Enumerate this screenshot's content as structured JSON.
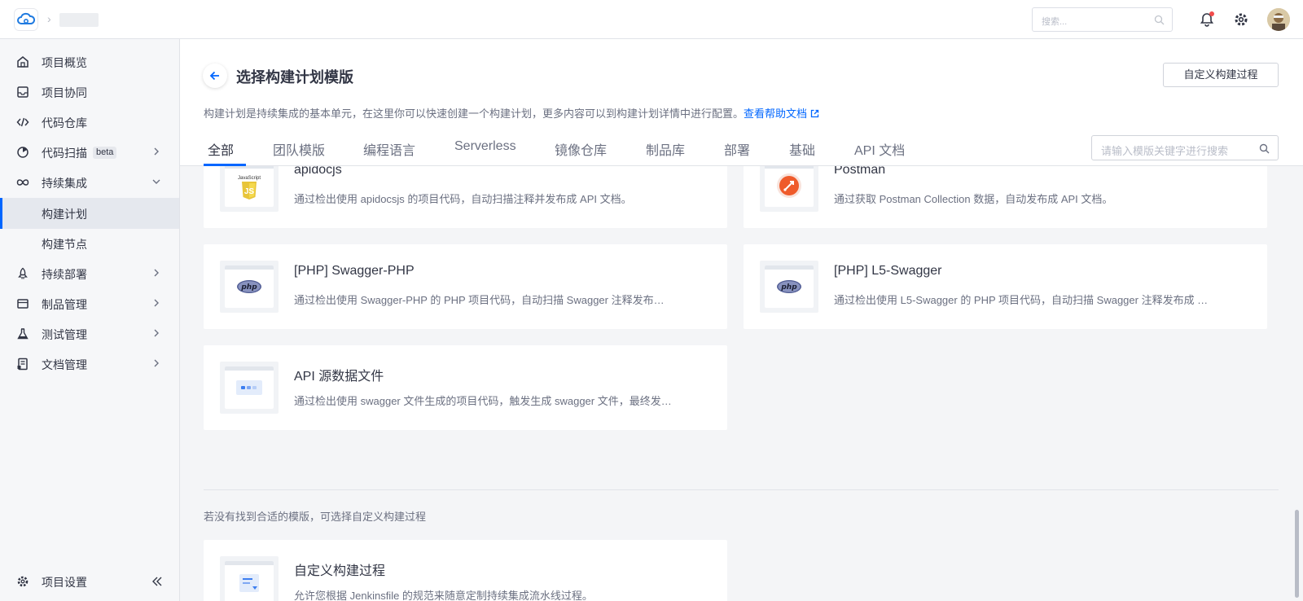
{
  "topbar": {
    "search_placeholder": "搜索..."
  },
  "sidebar": {
    "items": [
      {
        "label": "项目概览",
        "icon": "home-icon"
      },
      {
        "label": "项目协同",
        "icon": "inbox-icon"
      },
      {
        "label": "代码仓库",
        "icon": "code-icon"
      },
      {
        "label": "代码扫描",
        "icon": "scan-icon",
        "badge": "beta"
      },
      {
        "label": "持续集成",
        "icon": "infinity-icon"
      },
      {
        "label": "构建计划",
        "sub": true,
        "active": true
      },
      {
        "label": "构建节点",
        "sub": true
      },
      {
        "label": "持续部署",
        "icon": "rocket-icon"
      },
      {
        "label": "制品管理",
        "icon": "box-icon"
      },
      {
        "label": "测试管理",
        "icon": "flask-icon"
      },
      {
        "label": "文档管理",
        "icon": "document-icon"
      }
    ],
    "settings_label": "项目设置"
  },
  "header": {
    "title": "选择构建计划模版",
    "custom_button": "自定义构建过程",
    "description": "构建计划是持续集成的基本单元，在这里你可以快速创建一个构建计划，更多内容可以到构建计划详情中进行配置。",
    "help_link": "查看帮助文档"
  },
  "tabs": [
    {
      "label": "全部",
      "active": true
    },
    {
      "label": "团队模版"
    },
    {
      "label": "编程语言"
    },
    {
      "label": "Serverless"
    },
    {
      "label": "镜像仓库"
    },
    {
      "label": "制品库"
    },
    {
      "label": "部署"
    },
    {
      "label": "基础"
    },
    {
      "label": "API 文档"
    }
  ],
  "template_search_placeholder": "请输入模版关键字进行搜索",
  "templates": [
    {
      "title": "apidocjs",
      "desc": "通过检出使用 apidocsjs 的项目代码，自动扫描注释并发布成 API 文档。",
      "icon": "javascript-icon"
    },
    {
      "title": "Postman",
      "desc": "通过获取 Postman Collection 数据，自动发布成 API 文档。",
      "icon": "postman-icon"
    },
    {
      "title": "[PHP] Swagger-PHP",
      "desc": "通过检出使用 Swagger-PHP 的 PHP 项目代码，自动扫描 Swagger 注释发布…",
      "icon": "php-icon"
    },
    {
      "title": "[PHP] L5-Swagger",
      "desc": "通过检出使用 L5-Swagger 的 PHP 项目代码，自动扫描 Swagger 注释发布成 …",
      "icon": "php-icon"
    },
    {
      "title": "API 源数据文件",
      "desc": "通过检出使用 swagger 文件生成的项目代码，触发生成 swagger 文件，最终发…",
      "icon": "api-source-icon"
    }
  ],
  "custom_hint": "若没有找到合适的模版，可选择自定义构建过程",
  "custom_template": {
    "title": "自定义构建过程",
    "desc": "允许您根据 Jenkinsfile 的规范来随意定制持续集成流水线过程。"
  }
}
